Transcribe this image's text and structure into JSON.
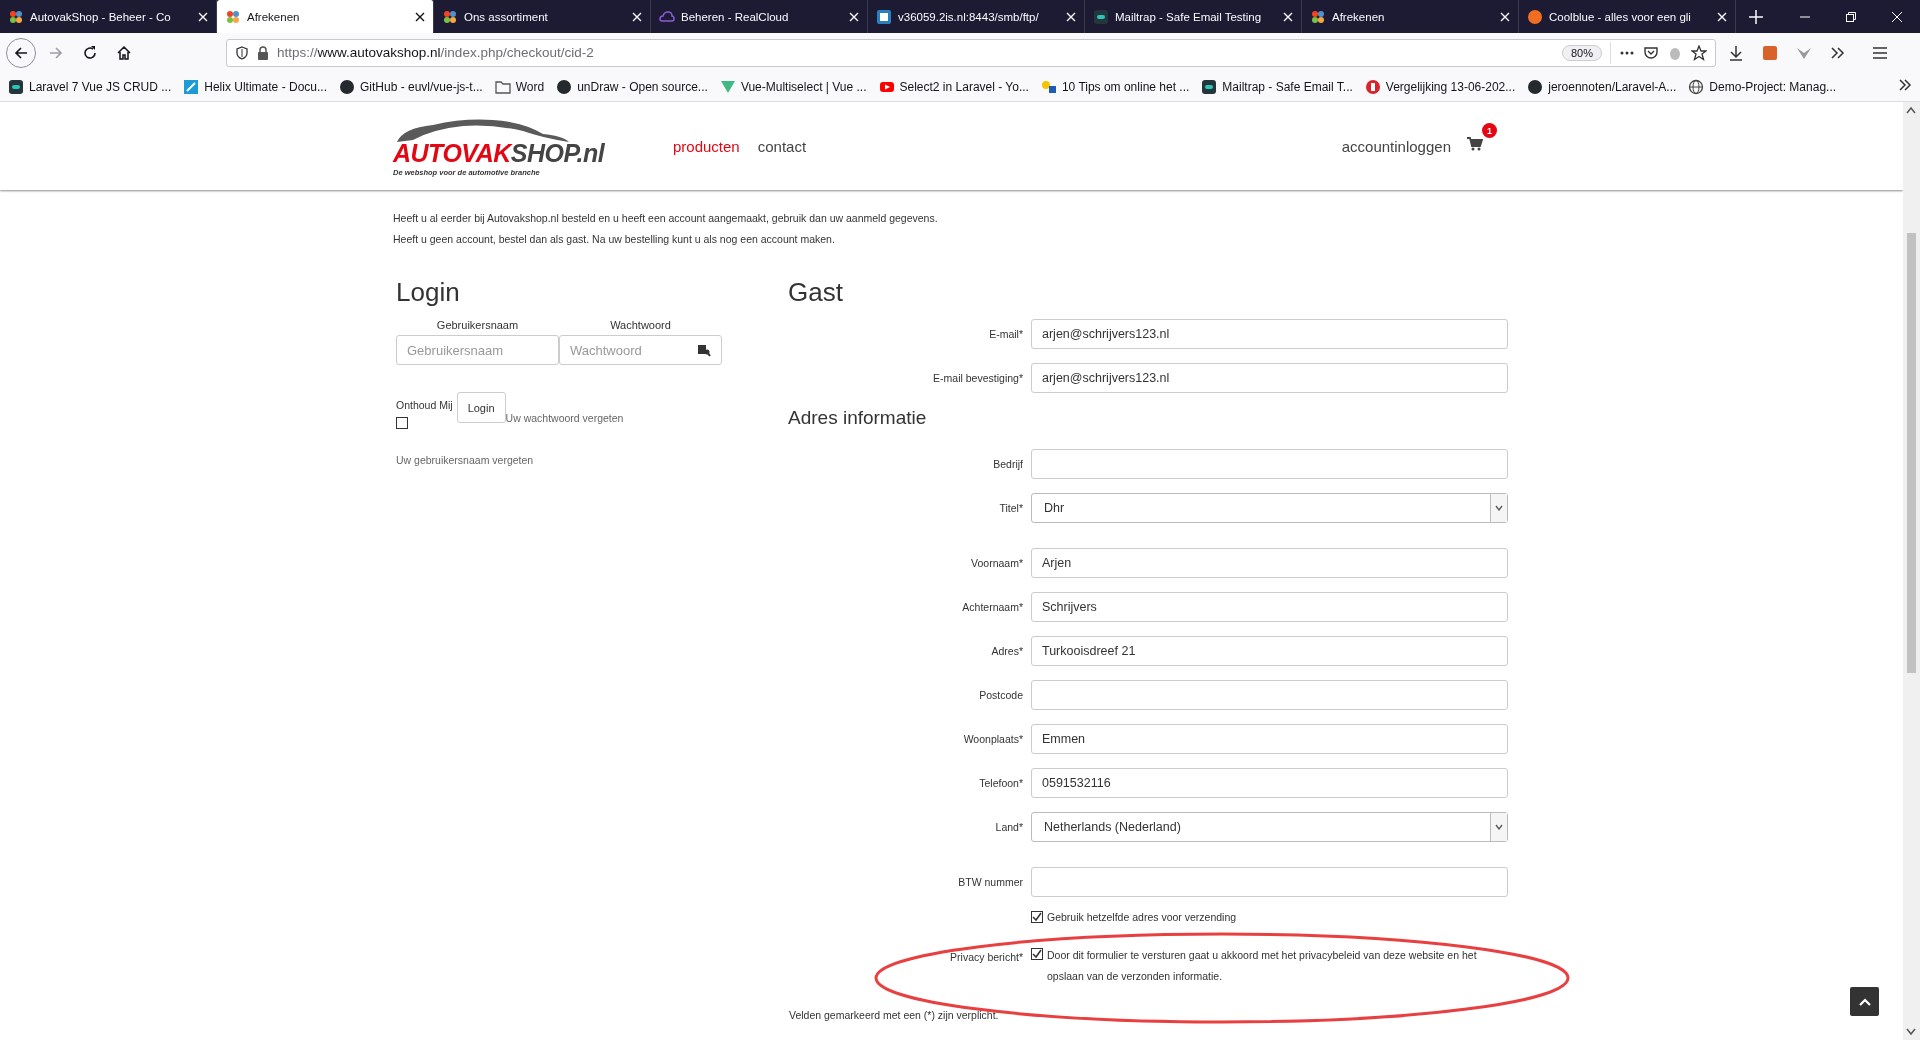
{
  "browser": {
    "tabs": [
      {
        "title": "AutovakShop - Beheer - Co",
        "selected": false
      },
      {
        "title": "Afrekenen",
        "selected": true
      },
      {
        "title": "Ons assortiment",
        "selected": false
      },
      {
        "title": "Beheren - RealCloud",
        "selected": false
      },
      {
        "title": "v36059.2is.nl:8443/smb/ftp/",
        "selected": false
      },
      {
        "title": "Mailtrap - Safe Email Testing",
        "selected": false
      },
      {
        "title": "Afrekenen",
        "selected": false
      },
      {
        "title": "Coolblue - alles voor een gli",
        "selected": false
      }
    ],
    "url": {
      "scheme": "https://",
      "host": "www.autovakshop.nl",
      "path": "/index.php/checkout/cid-2"
    },
    "zoom": "80%",
    "bookmarks": [
      "Laravel 7 Vue JS CRUD ...",
      "Helix Ultimate - Docu...",
      "GitHub - euvl/vue-js-t...",
      "Word",
      "unDraw - Open source...",
      "Vue-Multiselect | Vue ...",
      "Select2 in Laravel - Yo...",
      "10 Tips om online het ...",
      "Mailtrap - Safe Email T...",
      "Vergelijking 13-06-202...",
      "jeroennoten/Laravel-A...",
      "Demo-Project: Manag..."
    ]
  },
  "header": {
    "logo": {
      "part_1": "AUTOVAK",
      "part_2": "SHOP.nl",
      "tagline": "De webshop voor de automotive branche"
    },
    "nav": [
      {
        "label": "producten",
        "selected": true
      },
      {
        "label": "contact",
        "selected": false
      }
    ],
    "account": "accountinloggen",
    "cart_count": "1"
  },
  "intro": [
    "Heeft u al eerder bij Autovakshop.nl besteld en u heeft een account aangemaakt, gebruik dan uw aanmeld gegevens.",
    "Heeft u geen account, bestel dan als gast. Na uw bestelling kunt u als nog een account maken."
  ],
  "login": {
    "title": "Login",
    "fields": [
      {
        "label": "Gebruikersnaam",
        "placeholder": "Gebruikersnaam",
        "kind": "text"
      },
      {
        "label": "Wachtwoord",
        "placeholder": "Wachtwoord",
        "kind": "password"
      }
    ],
    "remember": {
      "label": "Onthoud Mij",
      "checked": false
    },
    "button": "Login",
    "password_link": "Uw wachtwoord vergeten",
    "username_link": "Uw gebruikersnaam vergeten"
  },
  "guest": {
    "title": "Gast",
    "fields": [
      {
        "kind": "text",
        "label": "E-mail*",
        "value": "arjen@schrijvers123.nl"
      },
      {
        "kind": "text",
        "label": "E-mail bevestiging*",
        "value": "arjen@schrijvers123.nl"
      },
      {
        "kind": "heading",
        "label": "Adres informatie"
      },
      {
        "kind": "text",
        "label": "Bedrijf"
      },
      {
        "kind": "select",
        "label": "Titel*",
        "value": "Dhr"
      },
      {
        "kind": "text",
        "label": "Voornaam*",
        "value": "Arjen"
      },
      {
        "kind": "text",
        "label": "Achternaam*",
        "value": "Schrijvers"
      },
      {
        "kind": "text",
        "label": "Adres*",
        "value": "Turkooisdreef 21"
      },
      {
        "kind": "text",
        "label": "Postcode"
      },
      {
        "kind": "text",
        "label": "Woonplaats*",
        "value": "Emmen"
      },
      {
        "kind": "text",
        "label": "Telefoon*",
        "value": "0591532116"
      },
      {
        "kind": "select",
        "label": "Land*",
        "value": "Netherlands (Nederland)"
      },
      {
        "kind": "text",
        "label": "BTW nummer"
      }
    ],
    "same_address": {
      "label": "Gebruik hetzelfde adres voor verzending",
      "checked": true
    },
    "privacy": {
      "caption": "Privacy bericht*",
      "label": "Door dit formulier te versturen gaat u akkoord met het privacybeleid van deze website en het opslaan van de verzonden informatie.",
      "checked": true
    },
    "note": "Velden gemarkeerd met een (*) zijn verplicht."
  }
}
